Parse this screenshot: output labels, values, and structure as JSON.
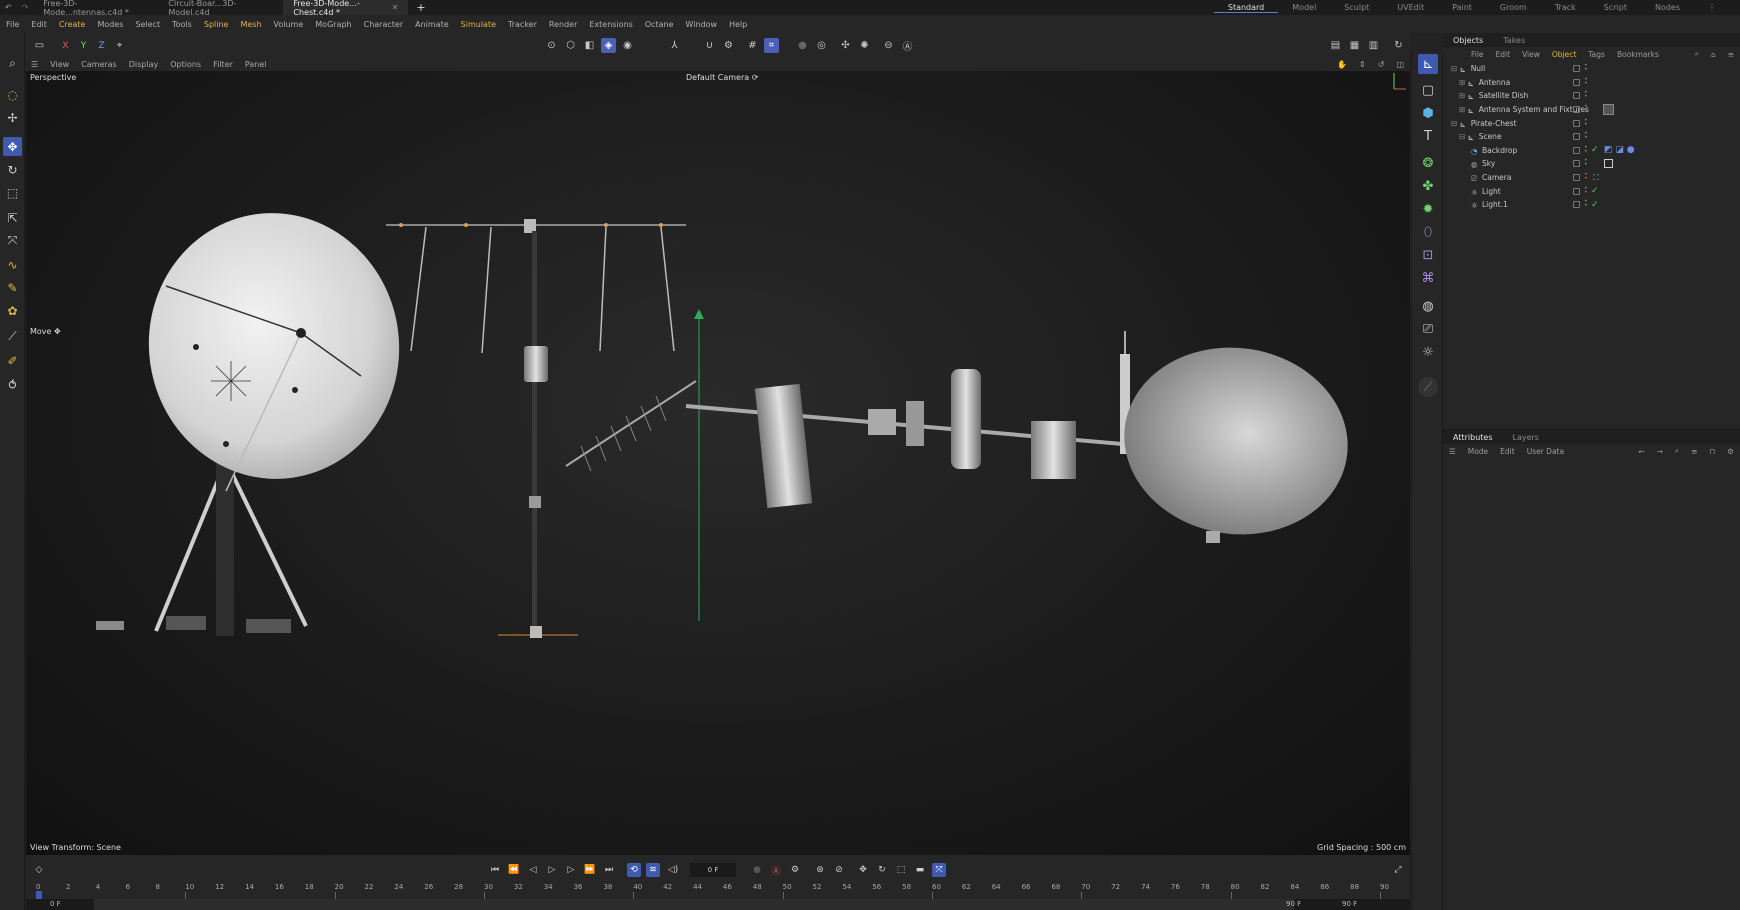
{
  "tabs": [
    {
      "label": "Free-3D-Mode...ntennas.c4d *",
      "active": false
    },
    {
      "label": "Circuit-Boar...3D-Model.c4d",
      "active": false
    },
    {
      "label": "Free-3D-Mode...-Chest.c4d *",
      "active": true
    }
  ],
  "layouts": [
    "Standard",
    "Model",
    "Sculpt",
    "UVEdit",
    "Paint",
    "Groom",
    "Track",
    "Script",
    "Nodes"
  ],
  "active_layout": "Standard",
  "menu": [
    "File",
    "Edit",
    "Create",
    "Modes",
    "Select",
    "Tools",
    "Spline",
    "Mesh",
    "Volume",
    "MoGraph",
    "Character",
    "Animate",
    "Simulate",
    "Tracker",
    "Render",
    "Extensions",
    "Octane",
    "Window",
    "Help"
  ],
  "axis_buttons": [
    "X",
    "Y",
    "Z"
  ],
  "viewport_menu": [
    "View",
    "Cameras",
    "Display",
    "Options",
    "Filter",
    "Panel"
  ],
  "viewport": {
    "name": "Perspective",
    "camera": "Default Camera",
    "tool": "Move",
    "view_transform": "View Transform: Scene",
    "grid_spacing": "Grid Spacing : 500 cm"
  },
  "objects_panel": {
    "tabs": [
      "Objects",
      "Takes"
    ],
    "menu": [
      "File",
      "Edit",
      "View",
      "Object",
      "Tags",
      "Bookmarks"
    ],
    "items": [
      {
        "label": "Null",
        "depth": 0,
        "tick": false
      },
      {
        "label": "Antenna",
        "depth": 1,
        "tick": false
      },
      {
        "label": "Satellite Dish",
        "depth": 1,
        "tick": false
      },
      {
        "label": "Antenna System and Fixtures",
        "depth": 1,
        "tick": false
      },
      {
        "label": "Pirate-Chest",
        "depth": 0,
        "tick": false
      },
      {
        "label": "Scene",
        "depth": 1,
        "tick": false
      },
      {
        "label": "Backdrop",
        "depth": 2,
        "tick": true
      },
      {
        "label": "Sky",
        "depth": 2,
        "tick": false
      },
      {
        "label": "Camera",
        "depth": 2,
        "tick": false
      },
      {
        "label": "Light",
        "depth": 2,
        "tick": true
      },
      {
        "label": "Light.1",
        "depth": 2,
        "tick": true
      }
    ]
  },
  "attributes_panel": {
    "tabs": [
      "Attributes",
      "Layers"
    ],
    "menu": [
      "Mode",
      "Edit",
      "User Data"
    ]
  },
  "timeline": {
    "current_frame": "0 F",
    "ticks": [
      "0",
      "2",
      "4",
      "6",
      "8",
      "10",
      "12",
      "14",
      "16",
      "18",
      "20",
      "22",
      "24",
      "26",
      "28",
      "30",
      "32",
      "34",
      "36",
      "38",
      "40",
      "42",
      "44",
      "46",
      "48",
      "50",
      "52",
      "54",
      "56",
      "58",
      "60",
      "62",
      "64",
      "66",
      "68",
      "70",
      "72",
      "74",
      "76",
      "78",
      "80",
      "82",
      "84",
      "86",
      "88",
      "90"
    ],
    "start": "0 F",
    "start2": "0 F",
    "end": "90 F",
    "end2": "90 F"
  },
  "accent_color": "#3f5ab0"
}
